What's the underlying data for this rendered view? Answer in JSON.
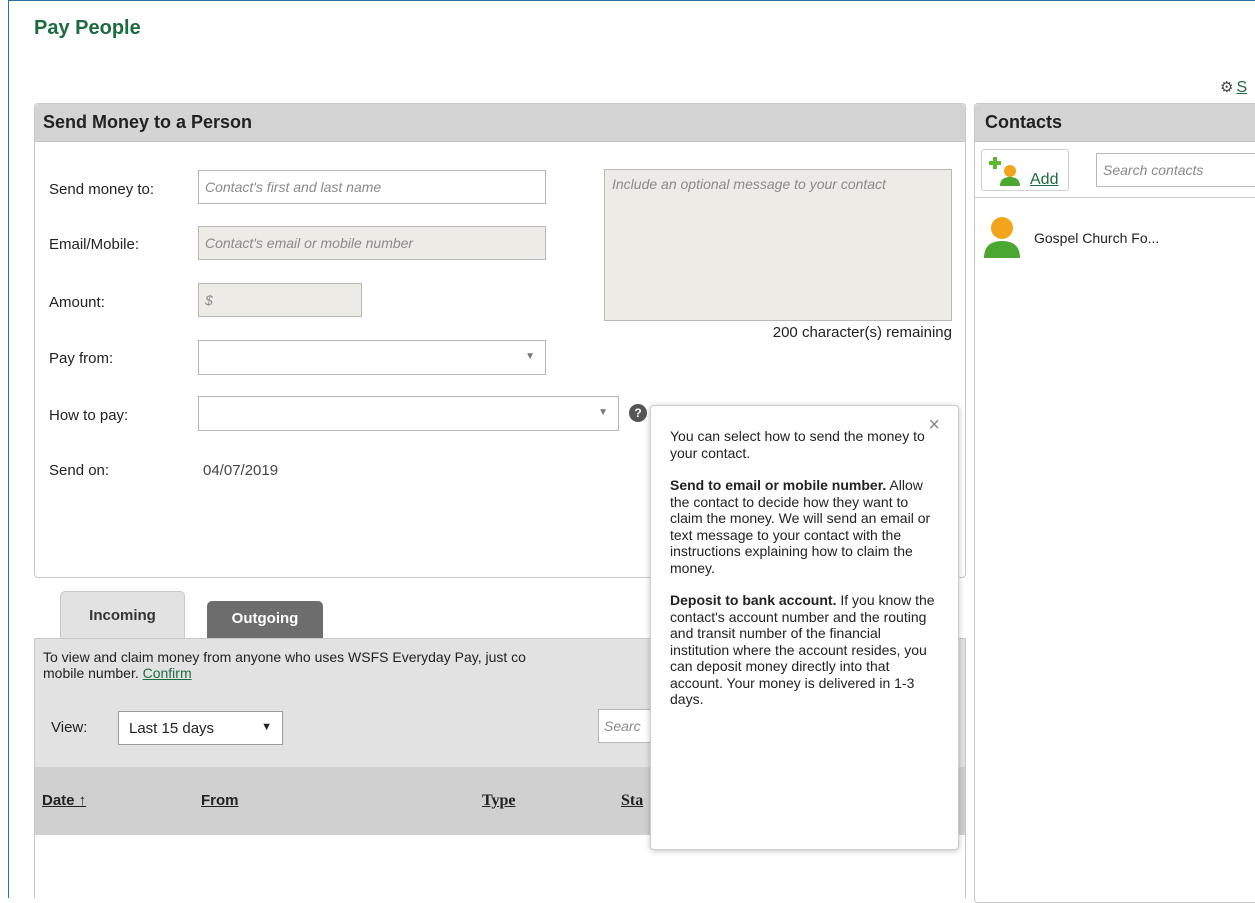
{
  "page": {
    "title": "Pay People",
    "settings_label": "S"
  },
  "send_panel": {
    "title": "Send Money to a Person",
    "labels": {
      "send_to": "Send money to:",
      "email_mobile": "Email/Mobile:",
      "amount": "Amount:",
      "pay_from": "Pay from:",
      "how_to_pay": "How to pay:",
      "send_on": "Send on:"
    },
    "placeholders": {
      "send_to": "Contact's first and last name",
      "email_mobile": "Contact's email or mobile number",
      "amount": "$",
      "message": "Include an optional message to your contact"
    },
    "chars_remaining": "200 character(s) remaining",
    "help_glyph": "?",
    "send_on_value": "04/07/2019"
  },
  "tabs": {
    "incoming": "Incoming",
    "outgoing": "Outgoing"
  },
  "incoming": {
    "notice_line1": "To view and claim money from anyone who uses WSFS Everyday Pay, just co",
    "notice_line2": "mobile number.",
    "confirm_link": "Confirm",
    "view_label": "View:",
    "view_value": "Last 15 days",
    "search_placeholder": "Searc",
    "columns": {
      "date": "Date ↑",
      "from": "From",
      "type": "Type",
      "status": "Sta"
    }
  },
  "contacts": {
    "title": "Contacts",
    "add_label": "Add",
    "search_placeholder": "Search contacts",
    "items": [
      {
        "name": "Gospel Church Fo..."
      }
    ]
  },
  "popover": {
    "close_glyph": "×",
    "intro": "You can select how to send the money to your contact.",
    "opt1_title": "Send to email or mobile number.",
    "opt1_text": "Allow the contact to decide how they want to claim the money. We will send an email or text message to your contact with the instructions explaining how to claim the money.",
    "opt2_title": "Deposit to bank account.",
    "opt2_text": "If you know the contact's account number and the routing and transit number of the financial institution where the account resides, you can deposit money directly into that account. Your money is delivered in 1-3 days."
  },
  "colors": {
    "brand_green": "#1d6b3e",
    "header_gray": "#d4d4d4",
    "field_gray": "#ecebe5",
    "tab_inactive": "#6d6d6d"
  }
}
